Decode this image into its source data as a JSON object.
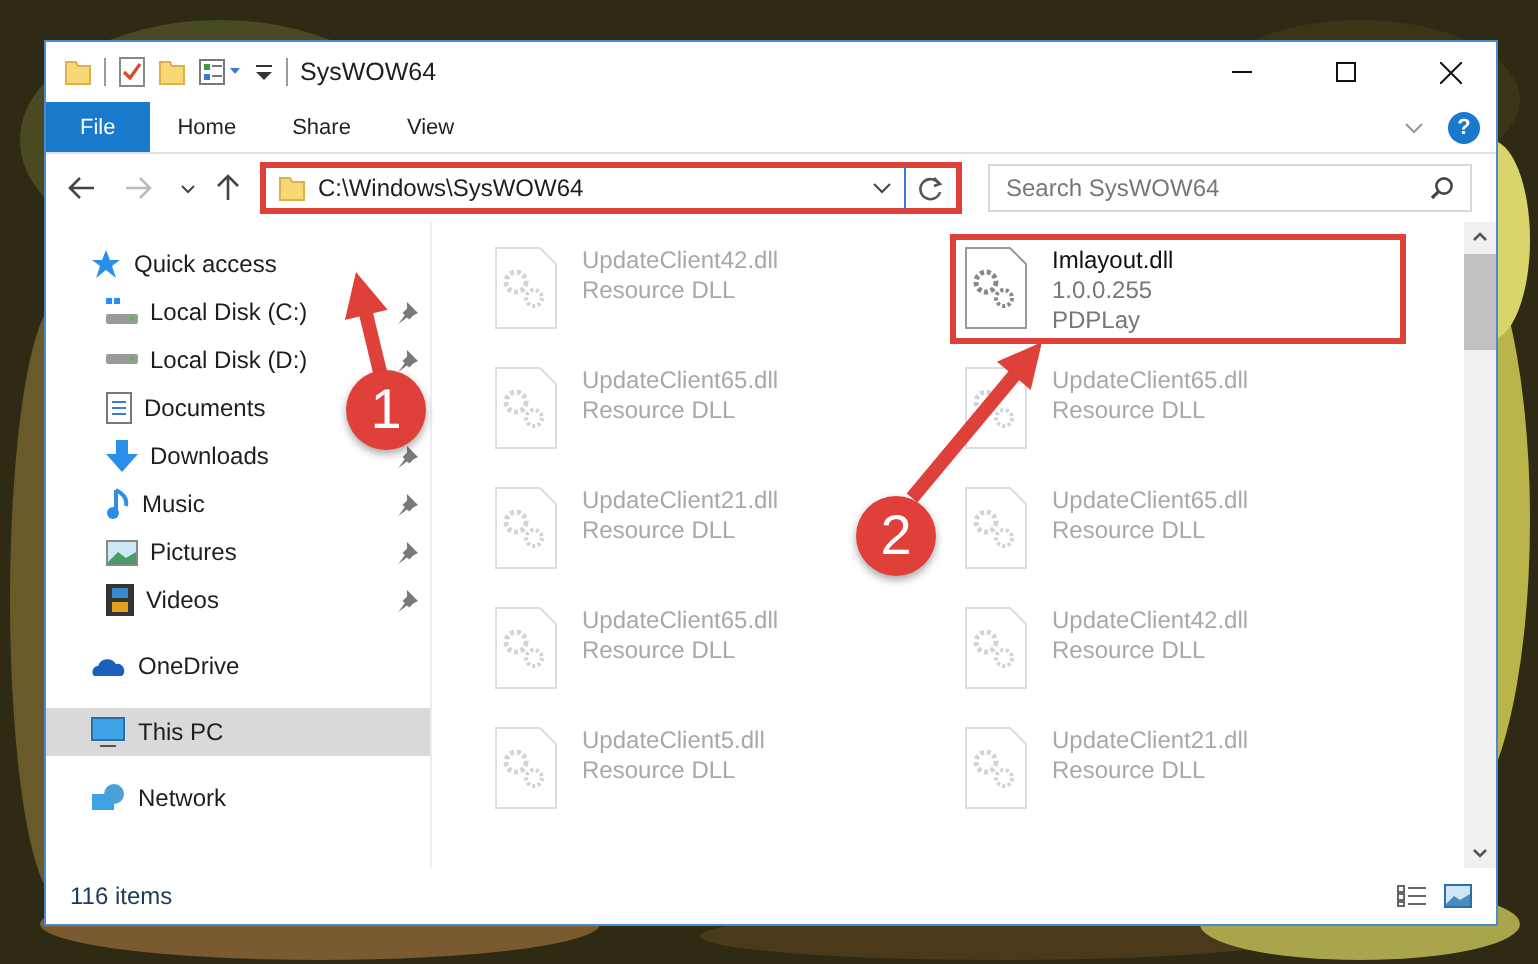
{
  "window": {
    "title": "SysWOW64"
  },
  "ribbon": {
    "tabs": [
      {
        "label": "File",
        "selected": true
      },
      {
        "label": "Home",
        "selected": false
      },
      {
        "label": "Share",
        "selected": false
      },
      {
        "label": "View",
        "selected": false
      }
    ],
    "help_label": "?"
  },
  "address_bar": {
    "path": "C:\\Windows\\SysWOW64",
    "annotated": true
  },
  "search": {
    "placeholder": "Search SysWOW64"
  },
  "sidebar": {
    "sections": [
      {
        "items": [
          {
            "label": "Quick access",
            "kind": "star",
            "selected": false,
            "children": [
              {
                "label": "Local Disk (C:)",
                "kind": "system-drive",
                "pinned": true,
                "selected": false
              },
              {
                "label": "Local Disk (D:)",
                "kind": "drive",
                "pinned": true,
                "selected": false
              },
              {
                "label": "Documents",
                "kind": "document",
                "pinned": false,
                "selected": false
              },
              {
                "label": "Downloads",
                "kind": "download",
                "pinned": true,
                "selected": false
              },
              {
                "label": "Music",
                "kind": "music",
                "pinned": true,
                "selected": false
              },
              {
                "label": "Pictures",
                "kind": "pictures",
                "pinned": true,
                "selected": false
              },
              {
                "label": "Videos",
                "kind": "videos",
                "pinned": true,
                "selected": false
              }
            ]
          }
        ]
      },
      {
        "items": [
          {
            "label": "OneDrive",
            "kind": "cloud",
            "selected": false
          }
        ]
      },
      {
        "items": [
          {
            "label": "This PC",
            "kind": "pc",
            "selected": true
          }
        ]
      },
      {
        "items": [
          {
            "label": "Network",
            "kind": "network",
            "selected": false
          }
        ]
      }
    ]
  },
  "files": [
    {
      "name": "UpdateClient42.dll",
      "details": [
        "Resource DLL"
      ],
      "blurred": true,
      "annotated": false
    },
    {
      "name": "Imlayout.dll",
      "details": [
        "1.0.0.255",
        "PDPLay"
      ],
      "blurred": false,
      "annotated": true
    },
    {
      "name": "UpdateClient65.dll",
      "details": [
        "Resource DLL"
      ],
      "blurred": true,
      "annotated": false
    },
    {
      "name": "UpdateClient65.dll",
      "details": [
        "Resource DLL"
      ],
      "blurred": true,
      "annotated": false
    },
    {
      "name": "UpdateClient21.dll",
      "details": [
        "Resource DLL"
      ],
      "blurred": true,
      "annotated": false
    },
    {
      "name": "UpdateClient65.dll",
      "details": [
        "Resource DLL"
      ],
      "blurred": true,
      "annotated": false
    },
    {
      "name": "UpdateClient65.dll",
      "details": [
        "Resource DLL"
      ],
      "blurred": true,
      "annotated": false
    },
    {
      "name": "UpdateClient42.dll",
      "details": [
        "Resource DLL"
      ],
      "blurred": true,
      "annotated": false
    },
    {
      "name": "UpdateClient5.dll",
      "details": [
        "Resource DLL"
      ],
      "blurred": true,
      "annotated": false
    },
    {
      "name": "UpdateClient21.dll",
      "details": [
        "Resource DLL"
      ],
      "blurred": true,
      "annotated": false
    }
  ],
  "status_bar": {
    "item_count": "116 items"
  },
  "annotations": [
    {
      "label": "1"
    },
    {
      "label": "2"
    }
  ]
}
